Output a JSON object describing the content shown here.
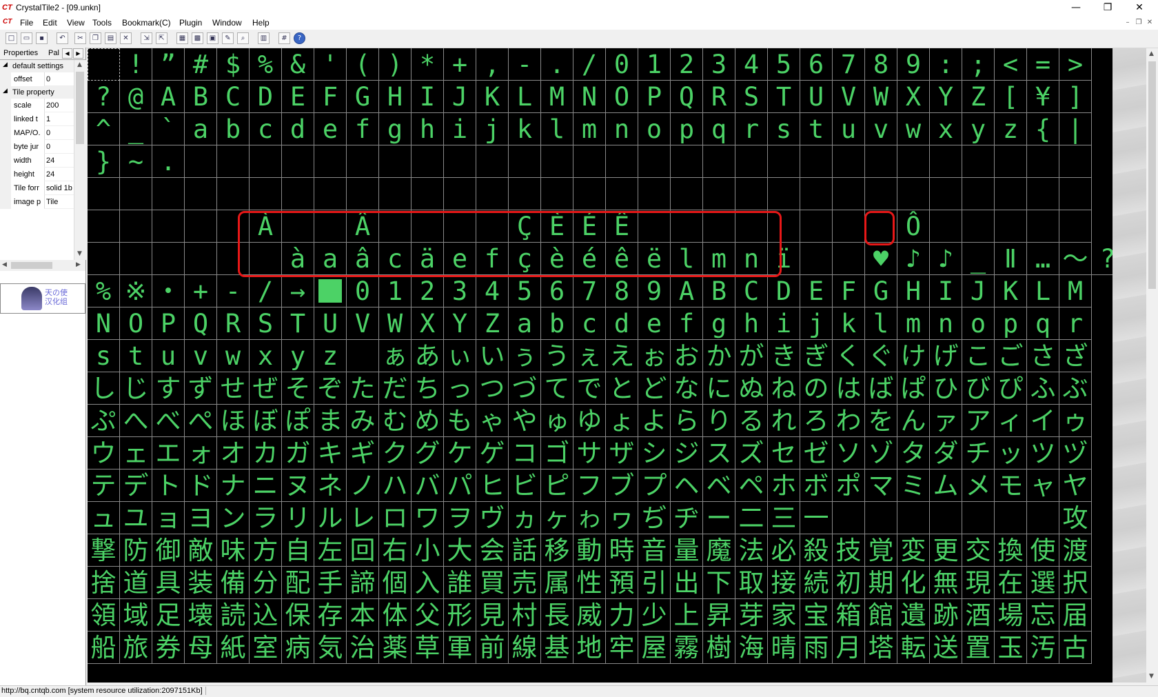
{
  "window": {
    "title": "CrystalTile2 - [09.unkn]",
    "app_icon": "crystaltile-icon",
    "minimize": "—",
    "maximize": "❐",
    "close": "✕"
  },
  "menu": {
    "items": [
      "File",
      "Edit",
      "View",
      "Tools",
      "Bookmark(C)",
      "Plugin",
      "Window",
      "Help"
    ]
  },
  "toolbar": {
    "buttons": [
      "new-icon",
      "open-icon",
      "save-icon",
      "undo-icon",
      "cut-icon",
      "copy-icon",
      "paste-icon",
      "delete-icon",
      "import-icon",
      "export-icon",
      "tile-view-icon",
      "tile-edit-icon",
      "palette-icon",
      "font-icon",
      "search-icon",
      "grid-tool-icon",
      "grid-toggle-icon",
      "help-icon"
    ]
  },
  "sidepanel": {
    "tabs": {
      "properties": "Properties",
      "palette": "Pal"
    },
    "groups": {
      "default": "default settings",
      "tile": "Tile property"
    },
    "rows": [
      {
        "key": "offset",
        "value": "0"
      },
      {
        "key": "scale",
        "value": "200"
      },
      {
        "key": "linked t",
        "value": "1"
      },
      {
        "key": "MAP/O.",
        "value": "0"
      },
      {
        "key": "byte jur",
        "value": "0"
      },
      {
        "key": "width",
        "value": "24"
      },
      {
        "key": "height",
        "value": "24"
      },
      {
        "key": "Tile forr",
        "value": "solid 1b"
      },
      {
        "key": "image p",
        "value": "Tile"
      }
    ],
    "logo_text": "天の使\n汉化组"
  },
  "tiles": {
    "rows": [
      [
        "",
        "!",
        "”",
        "#",
        "$",
        "%",
        "&",
        "'",
        "(",
        ")",
        "*",
        "+",
        ",",
        "-",
        ".",
        "/",
        "0",
        "1",
        "2",
        "3",
        "4",
        "5",
        "6",
        "7",
        "8",
        "9",
        ":",
        ";",
        "<",
        "=",
        ">"
      ],
      [
        "?",
        "@",
        "A",
        "B",
        "C",
        "D",
        "E",
        "F",
        "G",
        "H",
        "I",
        "J",
        "K",
        "L",
        "M",
        "N",
        "O",
        "P",
        "Q",
        "R",
        "S",
        "T",
        "U",
        "V",
        "W",
        "X",
        "Y",
        "Z",
        "[",
        "¥",
        "]"
      ],
      [
        "^",
        "_",
        "`",
        "a",
        "b",
        "c",
        "d",
        "e",
        "f",
        "g",
        "h",
        "i",
        "j",
        "k",
        "l",
        "m",
        "n",
        "o",
        "p",
        "q",
        "r",
        "s",
        "t",
        "u",
        "v",
        "w",
        "x",
        "y",
        "z",
        "{",
        "|"
      ],
      [
        "}",
        "~",
        ".",
        "",
        "",
        "",
        "",
        "",
        "",
        "",
        "",
        "",
        "",
        "",
        "",
        "",
        "",
        "",
        "",
        "",
        "",
        "",
        "",
        "",
        "",
        "",
        "",
        "",
        "",
        "",
        ""
      ],
      [
        "",
        "",
        "",
        "",
        "",
        "",
        "",
        "",
        "",
        "",
        "",
        "",
        "",
        "",
        "",
        "",
        "",
        "",
        "",
        "",
        "",
        "",
        "",
        "",
        "",
        "",
        "",
        "",
        "",
        "",
        ""
      ],
      [
        "",
        "",
        "",
        "",
        "",
        "À",
        "",
        "",
        "Â",
        "",
        "",
        "",
        "",
        "Ç",
        "È",
        "É",
        "Ê",
        "",
        "",
        "",
        "",
        "",
        "",
        "",
        "",
        "Ô",
        "",
        "",
        "",
        "",
        ""
      ],
      [
        "",
        "",
        "",
        "",
        "",
        "",
        "à",
        "a",
        "â",
        "c",
        "ä",
        "e",
        "f",
        "ç",
        "è",
        "é",
        "ê",
        "ë",
        "l",
        "m",
        "n",
        "ï",
        "",
        "",
        "♥",
        "♪",
        "♪",
        "_",
        "Ⅱ",
        "…",
        "～",
        "?"
      ],
      [
        "%",
        "※",
        "・",
        "+",
        "-",
        "/",
        "→",
        "■",
        "0",
        "1",
        "2",
        "3",
        "4",
        "5",
        "6",
        "7",
        "8",
        "9",
        "A",
        "B",
        "C",
        "D",
        "E",
        "F",
        "G",
        "H",
        "I",
        "J",
        "K",
        "L",
        "M"
      ],
      [
        "N",
        "O",
        "P",
        "Q",
        "R",
        "S",
        "T",
        "U",
        "V",
        "W",
        "X",
        "Y",
        "Z",
        "a",
        "b",
        "c",
        "d",
        "e",
        "f",
        "g",
        "h",
        "i",
        "j",
        "k",
        "l",
        "m",
        "n",
        "o",
        "p",
        "q",
        "r"
      ],
      [
        "s",
        "t",
        "u",
        "v",
        "w",
        "x",
        "y",
        "z",
        "",
        "ぁ",
        "あ",
        "ぃ",
        "い",
        "ぅ",
        "う",
        "ぇ",
        "え",
        "ぉ",
        "お",
        "か",
        "が",
        "き",
        "ぎ",
        "く",
        "ぐ",
        "け",
        "げ",
        "こ",
        "ご",
        "さ",
        "ざ"
      ],
      [
        "し",
        "じ",
        "す",
        "ず",
        "せ",
        "ぜ",
        "そ",
        "ぞ",
        "た",
        "だ",
        "ち",
        "っ",
        "つ",
        "づ",
        "て",
        "で",
        "と",
        "ど",
        "な",
        "に",
        "ぬ",
        "ね",
        "の",
        "は",
        "ば",
        "ぱ",
        "ひ",
        "び",
        "ぴ",
        "ふ",
        "ぶ"
      ],
      [
        "ぷ",
        "へ",
        "べ",
        "ぺ",
        "ほ",
        "ぼ",
        "ぽ",
        "ま",
        "み",
        "む",
        "め",
        "も",
        "ゃ",
        "や",
        "ゅ",
        "ゆ",
        "ょ",
        "よ",
        "ら",
        "り",
        "る",
        "れ",
        "ろ",
        "わ",
        "を",
        "ん",
        "ァ",
        "ア",
        "ィ",
        "イ",
        "ゥ"
      ],
      [
        "ウ",
        "ェ",
        "エ",
        "ォ",
        "オ",
        "カ",
        "ガ",
        "キ",
        "ギ",
        "ク",
        "グ",
        "ケ",
        "ゲ",
        "コ",
        "ゴ",
        "サ",
        "ザ",
        "シ",
        "ジ",
        "ス",
        "ズ",
        "セ",
        "ゼ",
        "ソ",
        "ゾ",
        "タ",
        "ダ",
        "チ",
        "ッ",
        "ツ",
        "ヅ"
      ],
      [
        "テ",
        "デ",
        "ト",
        "ド",
        "ナ",
        "ニ",
        "ヌ",
        "ネ",
        "ノ",
        "ハ",
        "バ",
        "パ",
        "ヒ",
        "ビ",
        "ピ",
        "フ",
        "ブ",
        "プ",
        "ヘ",
        "ベ",
        "ペ",
        "ホ",
        "ボ",
        "ポ",
        "マ",
        "ミ",
        "ム",
        "メ",
        "モ",
        "ャ",
        "ヤ"
      ],
      [
        "ュ",
        "ユ",
        "ョ",
        "ヨ",
        "ン",
        "ラ",
        "リ",
        "ル",
        "レ",
        "ロ",
        "ワ",
        "ヲ",
        "ヴ",
        "ヵ",
        "ヶ",
        "ゎ",
        "ヮ",
        "ぢ",
        "ヂ",
        "ー",
        "二",
        "三",
        "一",
        "",
        "",
        "",
        "",
        "",
        "",
        "",
        "攻"
      ],
      [
        "撃",
        "防",
        "御",
        "敵",
        "味",
        "方",
        "自",
        "左",
        "回",
        "右",
        "小",
        "大",
        "会",
        "話",
        "移",
        "動",
        "時",
        "音",
        "量",
        "魔",
        "法",
        "必",
        "殺",
        "技",
        "覚",
        "変",
        "更",
        "交",
        "換",
        "使",
        "渡"
      ],
      [
        "捨",
        "道",
        "具",
        "装",
        "備",
        "分",
        "配",
        "手",
        "諦",
        "個",
        "入",
        "誰",
        "買",
        "売",
        "属",
        "性",
        "預",
        "引",
        "出",
        "下",
        "取",
        "接",
        "続",
        "初",
        "期",
        "化",
        "無",
        "現",
        "在",
        "選",
        "択"
      ],
      [
        "領",
        "域",
        "足",
        "壊",
        "読",
        "込",
        "保",
        "存",
        "本",
        "体",
        "父",
        "形",
        "見",
        "村",
        "長",
        "威",
        "力",
        "少",
        "上",
        "昇",
        "芽",
        "家",
        "宝",
        "箱",
        "館",
        "遺",
        "跡",
        "酒",
        "場",
        "忘",
        "届"
      ],
      [
        "船",
        "旅",
        "券",
        "母",
        "紙",
        "室",
        "病",
        "気",
        "治",
        "薬",
        "草",
        "軍",
        "前",
        "線",
        "基",
        "地",
        "牢",
        "屋",
        "霧",
        "樹",
        "海",
        "晴",
        "雨",
        "月",
        "塔",
        "転",
        "送",
        "置",
        "玉",
        "汚",
        "古"
      ]
    ]
  },
  "status": {
    "text": "http://bq.cntqb.com [system resource utilization:2097151Kb]"
  },
  "colors": {
    "glyph": "#4cd266",
    "grid": "#8a8a8a",
    "highlight": "#e81818"
  }
}
